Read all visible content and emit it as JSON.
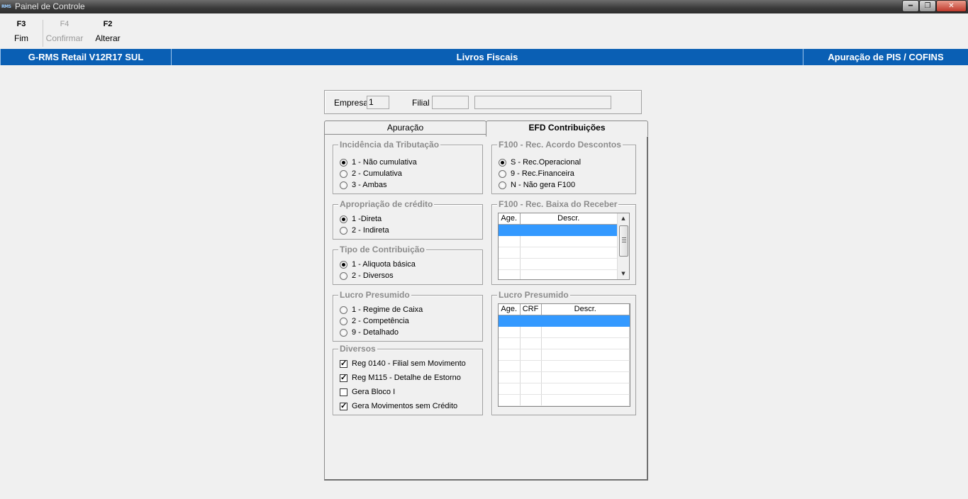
{
  "window": {
    "title": "Painel de Controle",
    "app_icon": "RMS"
  },
  "toolbar": [
    {
      "key": "F3",
      "label": "Fim",
      "enabled": true
    },
    {
      "key": "F4",
      "label": "Confirmar",
      "enabled": false
    },
    {
      "key": "F2",
      "label": "Alterar",
      "enabled": true
    }
  ],
  "banner": {
    "product": "G-RMS Retail V12R17 SUL",
    "module": "Livros Fiscais",
    "screen": "Apuração de PIS / COFINS"
  },
  "header": {
    "empresa_label": "Empresa",
    "empresa_value": "1",
    "filial_label": "Filial",
    "filial_value": "",
    "filial_name": ""
  },
  "tabs": [
    {
      "label": "Apuração",
      "active": false
    },
    {
      "label": "EFD Contribuições",
      "active": true
    }
  ],
  "incidencia": {
    "title": "Incidência da Tributação",
    "options": [
      "1 - Não cumulativa",
      "2 - Cumulativa",
      "3 - Ambas"
    ],
    "selected": 0
  },
  "apropriacao": {
    "title": "Apropriação de crédito",
    "options": [
      "1 -Direta",
      "2 - Indireta"
    ],
    "selected": 0
  },
  "tipo_contribuicao": {
    "title": "Tipo de Contribuição",
    "options": [
      "1 - Aliquota básica",
      "2 - Diversos"
    ],
    "selected": 0
  },
  "lucro_presumido_opts": {
    "title": "Lucro Presumido",
    "options": [
      "1 - Regime de Caixa",
      "2 - Competência",
      "9 - Detalhado"
    ],
    "selected": -1
  },
  "diversos": {
    "title": "Diversos",
    "items": [
      {
        "label": "Reg 0140 - Filial sem Movimento",
        "checked": true
      },
      {
        "label": "Reg M115 - Detalhe de Estorno",
        "checked": true
      },
      {
        "label": "Gera Bloco I",
        "checked": false
      },
      {
        "label": "Gera Movimentos sem Crédito",
        "checked": true
      }
    ]
  },
  "f100_acordo": {
    "title": "F100 - Rec. Acordo Descontos",
    "options": [
      "S - Rec.Operacional",
      "9 - Rec.Financeira",
      "N - Não gera F100"
    ],
    "selected": 0
  },
  "f100_baixa": {
    "title": "F100 - Rec. Baixa do Receber",
    "columns": [
      "Age.",
      "Descr."
    ]
  },
  "lucro_presumido_grid": {
    "title": "Lucro Presumido",
    "columns": [
      "Age.",
      "CRF",
      "Descr."
    ]
  }
}
